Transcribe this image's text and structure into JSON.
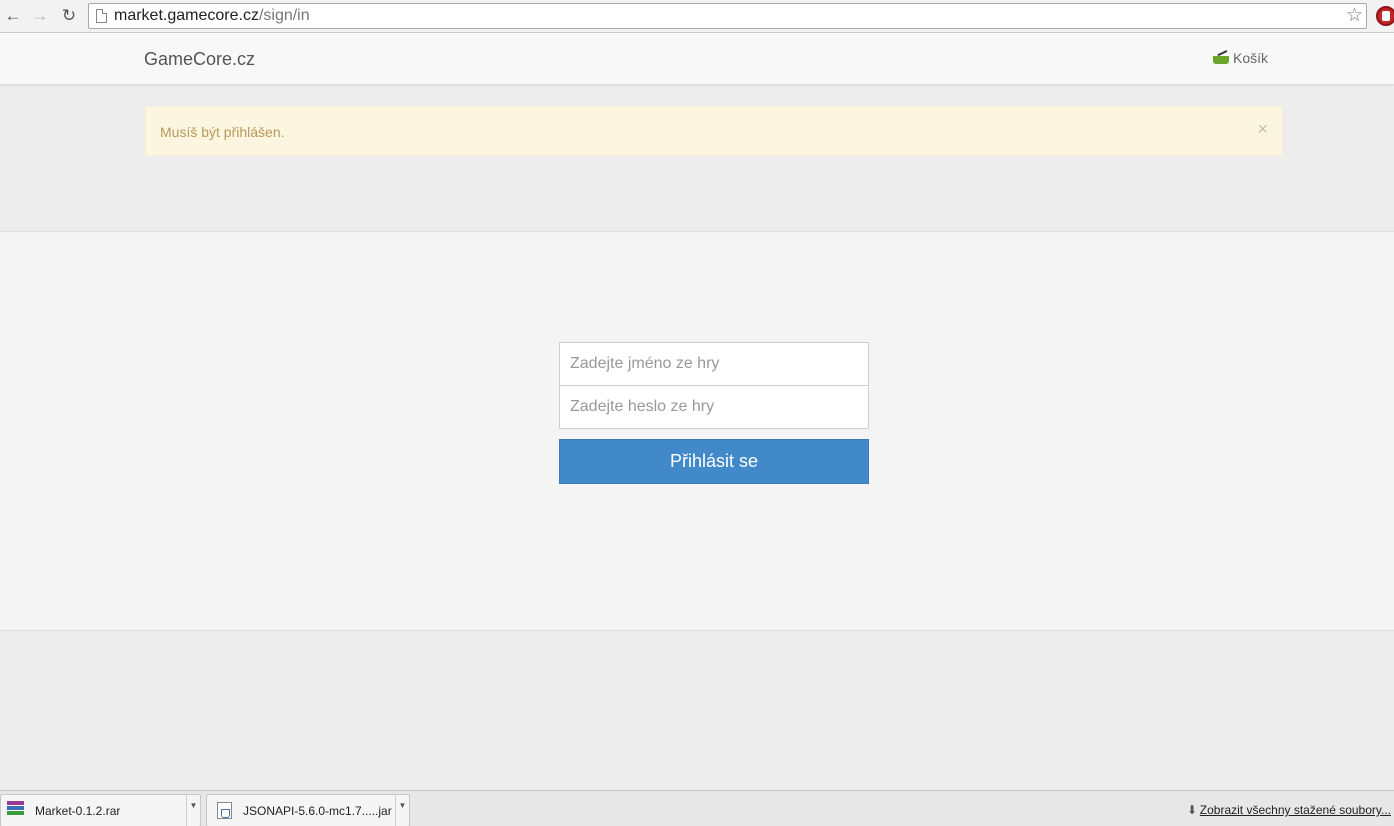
{
  "browser": {
    "url_host": "market.gamecore.cz",
    "url_path": "/sign/in",
    "icons": {
      "back": "back-arrow-icon",
      "forward": "forward-arrow-icon",
      "reload": "reload-icon",
      "star": "bookmark-star-icon",
      "extension": "adblock-icon"
    }
  },
  "navbar": {
    "brand": "GameCore.cz",
    "cart_label": "Košík"
  },
  "alert": {
    "message": "Musíš být přihlášen.",
    "close": "×"
  },
  "login_form": {
    "username_placeholder": "Zadejte jméno ze hry",
    "password_placeholder": "Zadejte heslo ze hry",
    "submit_label": "Přihlásit se"
  },
  "downloads": {
    "items": [
      {
        "name": "Market-0.1.2.rar"
      },
      {
        "name": "JSONAPI-5.6.0-mc1.7.....jar"
      }
    ],
    "show_all": "Zobrazit všechny stažené soubory..."
  },
  "colors": {
    "button": "#4289ca",
    "alert_bg": "#fcf6e1",
    "alert_text": "#b7995a"
  }
}
